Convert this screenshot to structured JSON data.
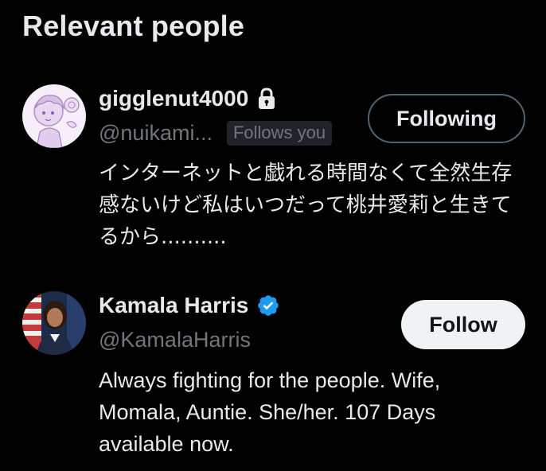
{
  "section": {
    "title": "Relevant people"
  },
  "people": [
    {
      "display_name": "gigglenut4000",
      "handle": "@nuikami...",
      "follows_you_badge": "Follows you",
      "protected_icon": "lock-icon",
      "button_label": "Following",
      "bio": "インターネットと戯れる時間なくて全然生存感ないけど私はいつだって桃井愛莉と生きてるから.........."
    },
    {
      "display_name": "Kamala Harris",
      "handle": "@KamalaHarris",
      "verified_icon": "verified-badge-icon",
      "button_label": "Follow",
      "bio": "Always fighting for the people. Wife, Momala, Auntie. She/her. 107 Days available now."
    }
  ],
  "colors": {
    "background": "#000000",
    "primary_text": "#e7e9ea",
    "secondary_text": "#71767b",
    "badge_bg": "#202327",
    "verified_blue": "#1d9bf0",
    "follow_button_bg": "#eff3f4",
    "following_button_border": "#536471"
  }
}
